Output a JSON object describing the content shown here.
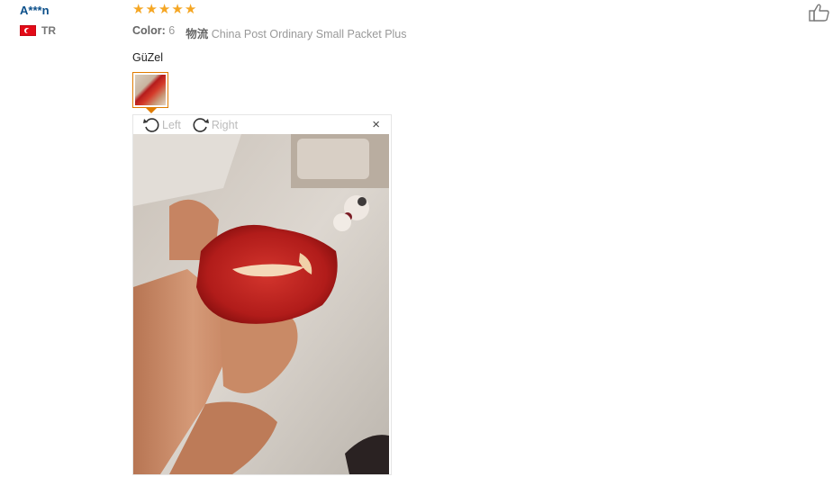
{
  "reviewer": {
    "name": "A***n",
    "country_code": "TR"
  },
  "review": {
    "rating": 5,
    "stars": [
      "★",
      "★",
      "★",
      "★",
      "★"
    ],
    "color_label": "Color:",
    "color_value": "6",
    "shipping_label": "物流",
    "shipping_value": "China Post Ordinary Small Packet Plus",
    "comment": "GüZel"
  },
  "viewer": {
    "rotate_left": "Left",
    "rotate_right": "Right",
    "close": "×"
  },
  "colors": {
    "accent": "#e07b00",
    "star": "#f5a623",
    "name": "#0b4f8a"
  }
}
